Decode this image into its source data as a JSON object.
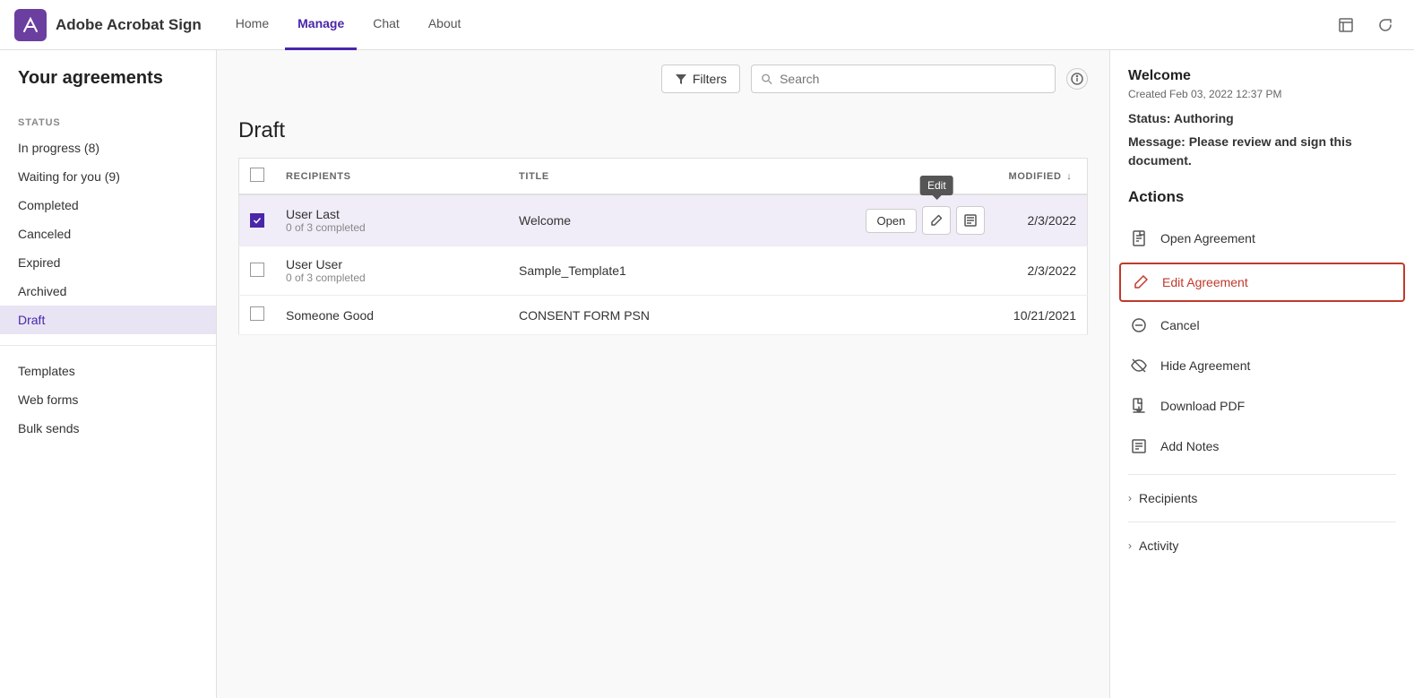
{
  "app": {
    "logo_char": "A",
    "title": "Adobe Acrobat Sign"
  },
  "nav": {
    "links": [
      {
        "id": "home",
        "label": "Home",
        "active": false
      },
      {
        "id": "manage",
        "label": "Manage",
        "active": true
      },
      {
        "id": "chat",
        "label": "Chat",
        "active": false
      },
      {
        "id": "about",
        "label": "About",
        "active": false
      }
    ]
  },
  "sidebar": {
    "title": "Your agreements",
    "status_label": "STATUS",
    "items": [
      {
        "id": "in-progress",
        "label": "In progress (8)",
        "active": false
      },
      {
        "id": "waiting-for-you",
        "label": "Waiting for you (9)",
        "active": false
      },
      {
        "id": "completed",
        "label": "Completed",
        "active": false
      },
      {
        "id": "canceled",
        "label": "Canceled",
        "active": false
      },
      {
        "id": "expired",
        "label": "Expired",
        "active": false
      },
      {
        "id": "archived",
        "label": "Archived",
        "active": false
      },
      {
        "id": "draft",
        "label": "Draft",
        "active": true
      }
    ],
    "other_items": [
      {
        "id": "templates",
        "label": "Templates"
      },
      {
        "id": "web-forms",
        "label": "Web forms"
      },
      {
        "id": "bulk-sends",
        "label": "Bulk sends"
      }
    ]
  },
  "content": {
    "filter_label": "Filters",
    "search_placeholder": "Search",
    "draft_title": "Draft",
    "table": {
      "headers": {
        "recipients": "RECIPIENTS",
        "title": "TITLE",
        "modified": "MODIFIED"
      },
      "rows": [
        {
          "id": "row1",
          "recipient_name": "User Last",
          "recipient_sub": "0 of 3 completed",
          "title": "Welcome",
          "modified": "2/3/2022",
          "selected": true,
          "show_actions": true
        },
        {
          "id": "row2",
          "recipient_name": "User User",
          "recipient_sub": "0 of 3 completed",
          "title": "Sample_Template1",
          "modified": "2/3/2022",
          "selected": false,
          "show_actions": false
        },
        {
          "id": "row3",
          "recipient_name": "Someone Good",
          "recipient_sub": "",
          "title": "CONSENT FORM PSN",
          "modified": "10/21/2021",
          "selected": false,
          "show_actions": false
        }
      ],
      "action_buttons": {
        "open": "Open",
        "edit_tooltip": "Edit"
      }
    }
  },
  "right_panel": {
    "doc_title": "Welcome",
    "created_label": "Created Feb 03, 2022 12:37 PM",
    "status_prefix": "Status: ",
    "status_value": "Authoring",
    "message_prefix": "Message: ",
    "message_value": "Please review and sign this document.",
    "actions_title": "Actions",
    "actions": [
      {
        "id": "open-agreement",
        "label": "Open Agreement",
        "icon": "doc-icon",
        "highlighted": false
      },
      {
        "id": "edit-agreement",
        "label": "Edit Agreement",
        "icon": "edit-icon",
        "highlighted": true
      },
      {
        "id": "cancel",
        "label": "Cancel",
        "icon": "cancel-icon",
        "highlighted": false
      },
      {
        "id": "hide-agreement",
        "label": "Hide Agreement",
        "icon": "hide-icon",
        "highlighted": false
      },
      {
        "id": "download-pdf",
        "label": "Download PDF",
        "icon": "download-icon",
        "highlighted": false
      },
      {
        "id": "add-notes",
        "label": "Add Notes",
        "icon": "notes-icon",
        "highlighted": false
      }
    ],
    "expandable": [
      {
        "id": "recipients",
        "label": "Recipients"
      },
      {
        "id": "activity",
        "label": "Activity"
      }
    ]
  }
}
